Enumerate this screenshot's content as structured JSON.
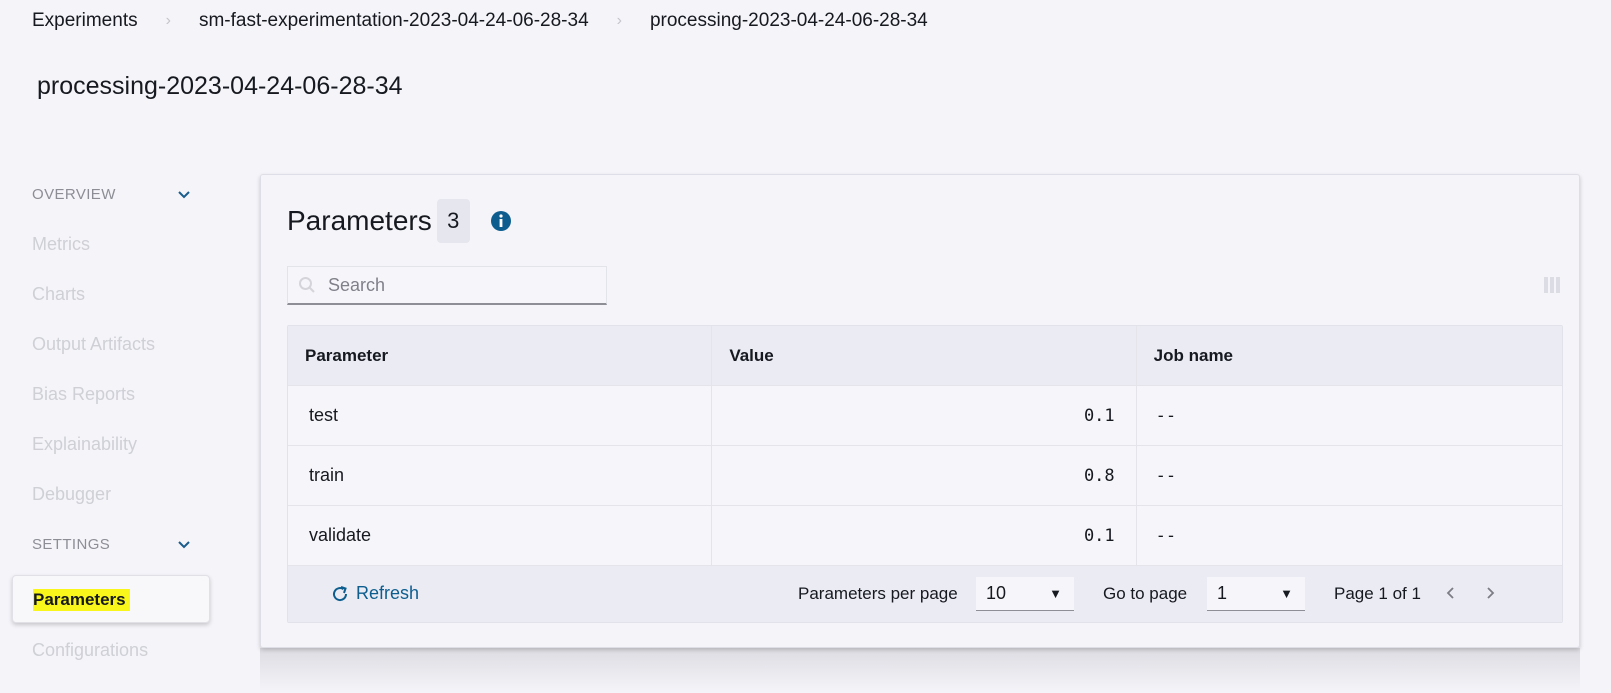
{
  "breadcrumb": [
    {
      "label": "Experiments"
    },
    {
      "label": "sm-fast-experimentation-2023-04-24-06-28-34"
    },
    {
      "label": "processing-2023-04-24-06-28-34"
    }
  ],
  "page_title": "processing-2023-04-24-06-28-34",
  "sidebar": {
    "overview_label": "OVERVIEW",
    "overview_items": [
      "Metrics",
      "Charts",
      "Output Artifacts",
      "Bias Reports",
      "Explainability",
      "Debugger"
    ],
    "settings_label": "SETTINGS",
    "active_item": "Parameters",
    "after_items": [
      "Configurations"
    ]
  },
  "panel": {
    "title": "Parameters",
    "count": "3",
    "search_placeholder": "Search",
    "columns": [
      "Parameter",
      "Value",
      "Job name"
    ],
    "rows": [
      {
        "parameter": "test",
        "value": "0.1",
        "job": "--"
      },
      {
        "parameter": "train",
        "value": "0.8",
        "job": "--"
      },
      {
        "parameter": "validate",
        "value": "0.1",
        "job": "--"
      }
    ],
    "footer": {
      "refresh_label": "Refresh",
      "per_page_label": "Parameters per page",
      "per_page_value": "10",
      "go_to_page_label": "Go to page",
      "go_to_page_value": "1",
      "page_info": "Page 1 of 1"
    }
  },
  "colors": {
    "accent": "#0d5e8f",
    "highlight": "#f9f61b",
    "background": "#f4f4f9"
  }
}
